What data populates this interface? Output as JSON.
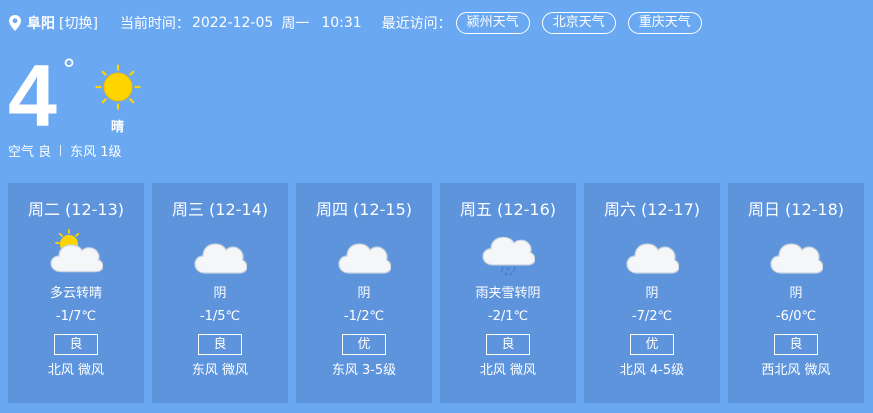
{
  "location": {
    "city": "阜阳",
    "switch_label": "[切换]"
  },
  "time": {
    "label": "当前时间：",
    "date": "2022-12-05",
    "weekday": "周一",
    "clock": "10:31"
  },
  "recent": {
    "label": "最近访问：",
    "links": [
      "颍州天气",
      "北京天气",
      "重庆天气"
    ]
  },
  "current": {
    "temperature": "4",
    "degree": "°",
    "condition": "晴",
    "icon": "sunny-icon",
    "air_quality": "空气 良",
    "wind": "东风 1级"
  },
  "forecast": [
    {
      "title": "周二 (12-13)",
      "icon": "partly-cloudy-icon",
      "condition": "多云转晴",
      "temp": "-1/7℃",
      "aqi": "良",
      "wind": "北风 微风"
    },
    {
      "title": "周三 (12-14)",
      "icon": "cloudy-icon",
      "condition": "阴",
      "temp": "-1/5℃",
      "aqi": "良",
      "wind": "东风 微风"
    },
    {
      "title": "周四 (12-15)",
      "icon": "cloudy-icon",
      "condition": "阴",
      "temp": "-1/2℃",
      "aqi": "优",
      "wind": "东风 3-5级"
    },
    {
      "title": "周五 (12-16)",
      "icon": "sleet-icon",
      "condition": "雨夹雪转阴",
      "temp": "-2/1℃",
      "aqi": "良",
      "wind": "北风 微风"
    },
    {
      "title": "周六 (12-17)",
      "icon": "cloudy-icon",
      "condition": "阴",
      "temp": "-7/2℃",
      "aqi": "优",
      "wind": "北风 4-5级"
    },
    {
      "title": "周日 (12-18)",
      "icon": "cloudy-icon",
      "condition": "阴",
      "temp": "-6/0℃",
      "aqi": "良",
      "wind": "西北风 微风"
    }
  ],
  "colors": {
    "background": "#6aa8f2",
    "card": "#5e94dc",
    "sun": "#ffd500",
    "cloud": "#f4f6f8"
  }
}
